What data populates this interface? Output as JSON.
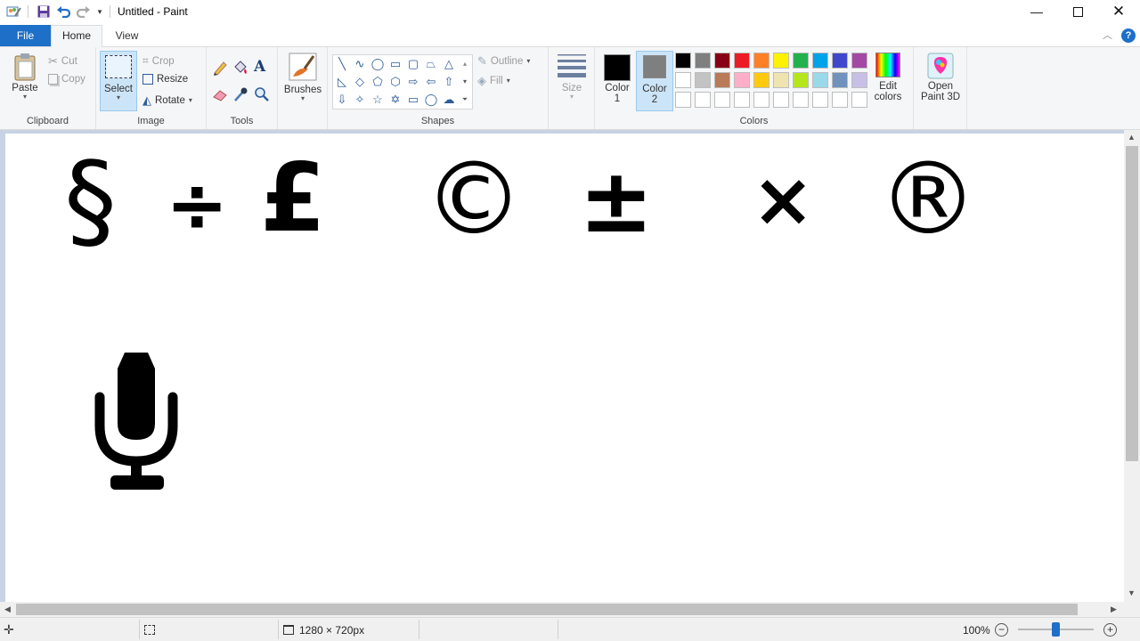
{
  "window": {
    "title": "Untitled - Paint",
    "minimize_icon": "minimize-icon",
    "maximize_icon": "maximize-icon",
    "close_icon": "close-icon"
  },
  "quick_access": [
    "paint-app-icon",
    "save-icon",
    "undo-icon",
    "redo-icon",
    "customize-dropdown-icon"
  ],
  "tabs": [
    {
      "label": "File",
      "active": false
    },
    {
      "label": "Home",
      "active": true
    },
    {
      "label": "View",
      "active": false
    }
  ],
  "ribbon": {
    "clipboard": {
      "paste": "Paste",
      "cut": "Cut",
      "copy": "Copy",
      "label": "Clipboard"
    },
    "image": {
      "select": "Select",
      "crop": "Crop",
      "resize": "Resize",
      "rotate": "Rotate",
      "label": "Image"
    },
    "tools": {
      "label": "Tools",
      "icons": [
        "pencil-icon",
        "fill-bucket-icon",
        "text-icon",
        "eraser-icon",
        "color-picker-icon",
        "magnifier-icon"
      ]
    },
    "brushes": {
      "label": "Brushes"
    },
    "shapes": {
      "outline": "Outline",
      "fill": "Fill",
      "label": "Shapes"
    },
    "size": {
      "label": "Size"
    },
    "colors": {
      "color1": "Color 1",
      "color2": "Color 2",
      "color1_value": "#000000",
      "color2_value": "#7f7f7f",
      "edit": "Edit colors",
      "label": "Colors",
      "palette_row1": [
        "#000000",
        "#7f7f7f",
        "#880015",
        "#ed1c24",
        "#ff7f27",
        "#fff200",
        "#22b14c",
        "#00a2e8",
        "#3f48cc",
        "#a349a4"
      ],
      "palette_row2": [
        "#ffffff",
        "#c3c3c3",
        "#b97a57",
        "#ffaec9",
        "#ffc90e",
        "#efe4b0",
        "#b5e61d",
        "#99d9ea",
        "#7092be",
        "#c8bfe7"
      ],
      "palette_row3": [
        "#ffffff",
        "#ffffff",
        "#ffffff",
        "#ffffff",
        "#ffffff",
        "#ffffff",
        "#ffffff",
        "#ffffff",
        "#ffffff",
        "#ffffff"
      ]
    },
    "paint3d": {
      "label": "Open Paint 3D"
    }
  },
  "canvas": {
    "symbols": [
      "§",
      "÷",
      "£",
      "©",
      "±",
      "×",
      "®"
    ],
    "microphone_icon": "microphone-icon"
  },
  "status": {
    "dimensions": "1280 × 720px",
    "zoom": "100%"
  }
}
